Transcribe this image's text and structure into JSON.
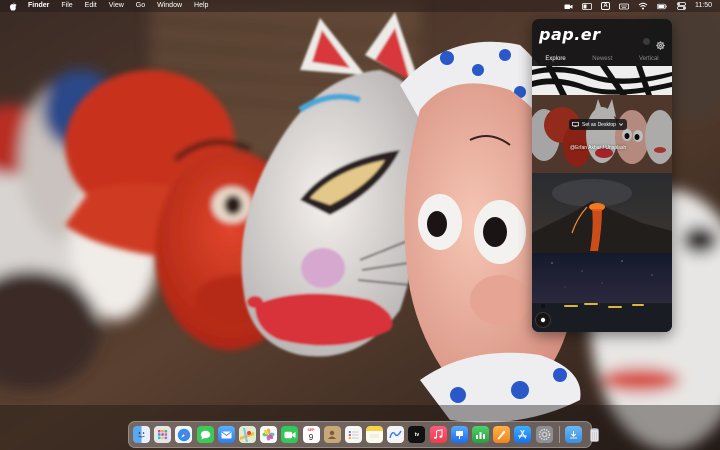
{
  "menubar": {
    "apple_icon": "apple-logo-icon",
    "items": [
      "Finder",
      "File",
      "Edit",
      "View",
      "Go",
      "Window",
      "Help"
    ],
    "input_source": "A",
    "clock": "11:50"
  },
  "paper": {
    "logo": "pap.er",
    "tabs": [
      "Explore",
      "Newest",
      "Vertical"
    ],
    "active_tab": "Explore",
    "set_desktop_label": "Set as Desktop",
    "photo_credit": "@Erfan Akbar / Unsplash"
  },
  "dock": {
    "apps": [
      {
        "name": "Finder",
        "icon": "finder-icon",
        "color": "#3d8fe6"
      },
      {
        "name": "Launchpad",
        "icon": "launchpad-icon",
        "color": "#e8e8ec"
      },
      {
        "name": "Safari",
        "icon": "safari-icon",
        "color": "#2f8ef0"
      },
      {
        "name": "Messages",
        "icon": "messages-icon",
        "color": "#3bc95a"
      },
      {
        "name": "Mail",
        "icon": "mail-icon",
        "color": "#3a8ef5"
      },
      {
        "name": "Maps",
        "icon": "maps-icon",
        "color": "#6bbd6b"
      },
      {
        "name": "Photos",
        "icon": "photos-icon",
        "color": "#f2f2f2"
      },
      {
        "name": "FaceTime",
        "icon": "facetime-icon",
        "color": "#34c759"
      },
      {
        "name": "Calendar",
        "icon": "calendar-icon",
        "color": "#ffffff"
      },
      {
        "name": "Contacts",
        "icon": "contacts-icon",
        "color": "#c8a878"
      },
      {
        "name": "Reminders",
        "icon": "reminders-icon",
        "color": "#f5f5f5"
      },
      {
        "name": "Notes",
        "icon": "notes-icon",
        "color": "#f7d34a"
      },
      {
        "name": "Freeform",
        "icon": "freeform-icon",
        "color": "#f2f2f2"
      },
      {
        "name": "TV",
        "icon": "tv-icon",
        "color": "#111111"
      },
      {
        "name": "Music",
        "icon": "music-icon",
        "color": "#f34b5f"
      },
      {
        "name": "Keynote",
        "icon": "keynote-icon",
        "color": "#2d7ef0"
      },
      {
        "name": "Numbers",
        "icon": "numbers-icon",
        "color": "#33b44a"
      },
      {
        "name": "Pages",
        "icon": "pages-icon",
        "color": "#f19a2b"
      },
      {
        "name": "App Store",
        "icon": "app-store-icon",
        "color": "#1c8ef6"
      },
      {
        "name": "System Settings",
        "icon": "system-settings-icon",
        "color": "#8e8e93"
      },
      {
        "name": "Downloads",
        "icon": "downloads-folder-icon",
        "color": "#57a5e6"
      },
      {
        "name": "Trash",
        "icon": "trash-icon",
        "color": "#d8d8dc"
      }
    ],
    "calendar_month": "SEP",
    "calendar_day": "9",
    "tv_label": "tv"
  }
}
